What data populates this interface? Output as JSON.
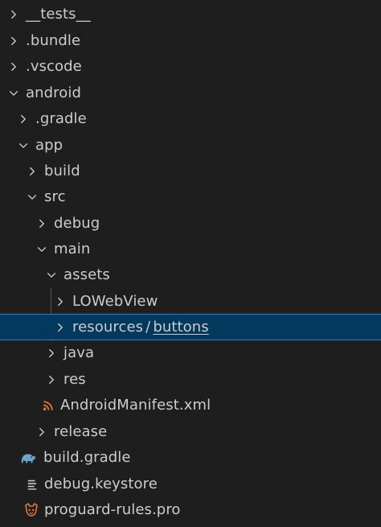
{
  "explorer": {
    "items": [
      {
        "label": "__tests__",
        "icon": "chevron-right-icon"
      },
      {
        "label": ".bundle",
        "icon": "chevron-right-icon"
      },
      {
        "label": ".vscode",
        "icon": "chevron-right-icon"
      },
      {
        "label": "android",
        "icon": "chevron-down-icon"
      },
      {
        "label": ".gradle",
        "icon": "chevron-right-icon"
      },
      {
        "label": "app",
        "icon": "chevron-down-icon"
      },
      {
        "label": "build",
        "icon": "chevron-right-icon"
      },
      {
        "label": "src",
        "icon": "chevron-down-icon"
      },
      {
        "label": "debug",
        "icon": "chevron-right-icon"
      },
      {
        "label": "main",
        "icon": "chevron-down-icon"
      },
      {
        "label": "assets",
        "icon": "chevron-down-icon"
      },
      {
        "label": "LOWebView",
        "icon": "chevron-right-icon"
      },
      {
        "label_parts": [
          "resources",
          "/",
          "buttons"
        ],
        "icon": "chevron-right-icon",
        "selected": true
      },
      {
        "label": "java",
        "icon": "chevron-right-icon"
      },
      {
        "label": "res",
        "icon": "chevron-right-icon"
      },
      {
        "label": "AndroidManifest.xml",
        "icon": "rss-icon"
      },
      {
        "label": "release",
        "icon": "chevron-right-icon"
      },
      {
        "label": "build.gradle",
        "icon": "gradle-elephant-icon"
      },
      {
        "label": "debug.keystore",
        "icon": "lines-file-icon"
      },
      {
        "label": "proguard-rules.pro",
        "icon": "proguard-icon"
      }
    ]
  },
  "colors": {
    "background": "#1e1e1e",
    "text": "#cccccc",
    "selection": "#04395e",
    "selection_border": "#1f7fd6",
    "gradle_icon": "#6aa6c8",
    "rss_icon": "#e37933",
    "proguard_icon": "#e37933"
  }
}
